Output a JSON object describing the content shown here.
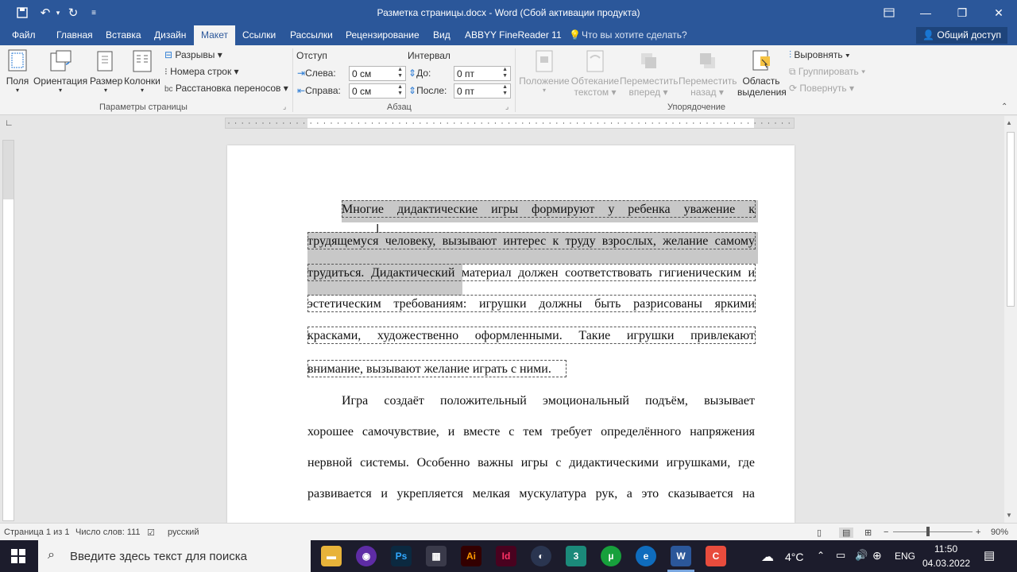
{
  "window": {
    "title": "Разметка страницы.docx - Word (Сбой активации продукта)"
  },
  "tabs": [
    "Файл",
    "Главная",
    "Вставка",
    "Дизайн",
    "Макет",
    "Ссылки",
    "Рассылки",
    "Рецензирование",
    "Вид",
    "ABBYY FineReader 11"
  ],
  "tell_me": "Что вы хотите сделать?",
  "share": "Общий доступ",
  "ribbon": {
    "page_setup": {
      "fields": "Поля",
      "orientation": "Ориентация",
      "size": "Размер",
      "columns": "Колонки",
      "breaks": "Разрывы",
      "line_numbers": "Номера строк",
      "hyphenation": "Расстановка переносов",
      "group": "Параметры страницы"
    },
    "paragraph": {
      "indent": "Отступ",
      "spacing": "Интервал",
      "left_label": "Слева:",
      "left_value": "0 см",
      "right_label": "Справа:",
      "right_value": "0 см",
      "before_label": "До:",
      "before_value": "0 пт",
      "after_label": "После:",
      "after_value": "0 пт",
      "group": "Абзац"
    },
    "arrange": {
      "position_1": "Положение",
      "wrap_1": "Обтекание",
      "wrap_2": "текстом",
      "forward_1": "Переместить",
      "forward_2": "вперед",
      "backward_1": "Переместить",
      "backward_2": "назад",
      "selection_1": "Область",
      "selection_2": "выделения",
      "align": "Выровнять",
      "group_btn": "Группировать",
      "rotate": "Повернуть",
      "group": "Упорядочение"
    }
  },
  "document": {
    "lines": [
      "Многие дидактические игры формируют у ребенка уважение к",
      "трудящемуся человеку, вызывают интерес к труду взрослых, желание самому",
      "трудиться. Дидактический материал должен соответствовать гигиеническим и",
      "эстетическим требованиям: игрушки должны быть разрисованы яркими",
      "красками, художественно оформленными. Такие игрушки привлекают",
      "внимание, вызывают желание играть с ними.",
      "Игра создаёт положительный эмоциональный подъём, вызывает",
      "хорошее самочувствие, и вместе с тем требует определённого напряжения",
      "нервной системы. Особенно важны игры с дидактическими игрушками, где",
      "развивается и укрепляется мелкая мускулатура рук, а это сказывается на"
    ]
  },
  "status": {
    "page": "Страница 1 из 1",
    "words": "Число слов: 111",
    "language": "русский",
    "zoom": "90%"
  },
  "taskbar": {
    "search_placeholder": "Введите здесь текст для поиска",
    "temperature": "4°C",
    "lang": "ENG",
    "time": "11:50",
    "date": "04.03.2022"
  }
}
